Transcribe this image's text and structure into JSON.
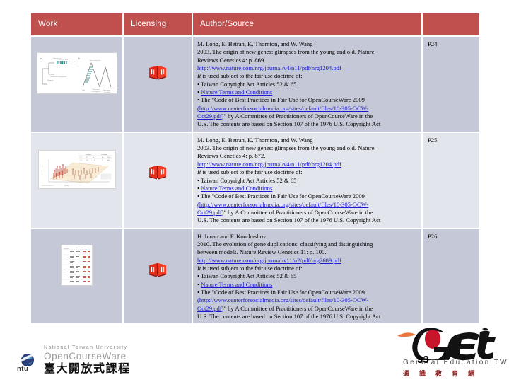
{
  "table": {
    "headers": [
      "Work",
      "Licensing",
      "Author/Source",
      ""
    ],
    "rows": [
      {
        "page": "P24",
        "work_icon": "figure-thumbnail-phylogenetic-tree",
        "license_icon": "red-open-book-icon",
        "source": {
          "authors": "M. Long, E. Betran, K. Thornton, and W. Wang",
          "citation_line1": "2003. The origin of new genes: glimpses from the young and old. Nature",
          "citation_line2": "Reviews Genetics 4: p. 869.",
          "url": "http://www.nature.com/nrg/journal/v4/n11/pdf/nrg1204.pdf",
          "fair_use_intro_italic": "It",
          "fair_use_intro_rest": " is used subject to the fair use doctrine of:",
          "bullet1": "• Taiwan Copyright Act Articles 52 & 65",
          "bullet2_marker": "• ",
          "bullet2_link": "Nature Terms and Conditions",
          "bullet3_line1": "• The \"Code of Best Practices in Fair Use for OpenCourseWare 2009",
          "bullet3_open_paren": "(",
          "bullet3_url_part1": "http://www.centerforsocialmedia.org/sites/default/files/10-305-OCW-",
          "bullet3_url_part2": "Oct29.pdf",
          "bullet3_line2_rest": ")\" by A Committee of Practitioners of OpenCourseWare in the",
          "bullet3_line3": "U.S. The contents are based on Section 107 of the 1976 U.S. Copyright Act"
        }
      },
      {
        "page": "P25",
        "work_icon": "figure-thumbnail-3d-scatter-plot",
        "license_icon": "red-open-book-icon",
        "source": {
          "authors": "M. Long, E. Betran, K. Thornton, and W. Wang",
          "citation_line1": "2003. The origin of new genes: glimpses from the young and old. Nature",
          "citation_line2": "Reviews Genetics 4: p. 872.",
          "url": "http://www.nature.com/nrg/journal/v4/n11/pdf/nrg1204.pdf",
          "fair_use_intro_italic": "It",
          "fair_use_intro_rest": " is used subject to the fair use doctrine of:",
          "bullet1": "• Taiwan Copyright Act Articles 52 & 65",
          "bullet2_marker": "• ",
          "bullet2_link": "Nature Terms and Conditions",
          "bullet3_line1": "• The \"Code of Best Practices in Fair Use for OpenCourseWare 2009",
          "bullet3_open_paren": "(",
          "bullet3_url_part1": "http://www.centerforsocialmedia.org/sites/default/files/10-305-OCW-",
          "bullet3_url_part2": "Oct29.pdf",
          "bullet3_line2_rest": ")\" by A Committee of Practitioners of OpenCourseWare in the",
          "bullet3_line3": "U.S. The contents are based on Section 107 of the 1976 U.S. Copyright Act"
        }
      },
      {
        "page": "P26",
        "work_icon": "figure-thumbnail-data-table",
        "license_icon": "red-open-book-icon",
        "source": {
          "authors": "H. Innan and F. Kondrashov",
          "citation_line1": "2010. The evolution of gene duplications: classifying and distinguishing",
          "citation_line2": "between models. Nature Review Genetics  11: p. 100.",
          "url": "http://www.nature.com/nrg/journal/v11/n2/pdf/nrg2689.pdf",
          "fair_use_intro_italic": "It",
          "fair_use_intro_rest": " is used subject to the fair use doctrine of:",
          "bullet1": "• Taiwan Copyright Act Articles 52 & 65",
          "bullet2_marker": "• ",
          "bullet2_link": "Nature Terms and Conditions",
          "bullet3_line1": "• The \"Code of Best Practices in Fair Use for OpenCourseWare 2009",
          "bullet3_open_paren": "(",
          "bullet3_url_part1": "http://www.centerforsocialmedia.org/sites/default/files/10-305-OCW-",
          "bullet3_url_part2": "Oct29.pdf",
          "bullet3_line2_rest": ")\" by A Committee of Practitioners of OpenCourseWare in the",
          "bullet3_line3": "U.S. The contents are based on Section 107 of the 1976 U.S. Copyright Act"
        }
      }
    ]
  },
  "footer": {
    "ntu": {
      "line1": "National Taiwan University",
      "line2": "OpenCourseWare",
      "line3": "臺大開放式課程",
      "mark": "ntu",
      "icon": "ntu-globe-logo"
    },
    "get": {
      "wordmark": "GET",
      "subtitle": "General Education TW",
      "chinese": "通識教育網",
      "icon": "get-brush-logo"
    },
    "slide_number": "33"
  },
  "colors": {
    "header_bg": "#c0504d",
    "header_text": "#ffffff",
    "row_bg": "#c5c8d6",
    "row_alt_bg": "#e3e5ec",
    "link": "#1a1ad0",
    "book_icon": "#e02020",
    "page_bg": "#ffffff"
  }
}
